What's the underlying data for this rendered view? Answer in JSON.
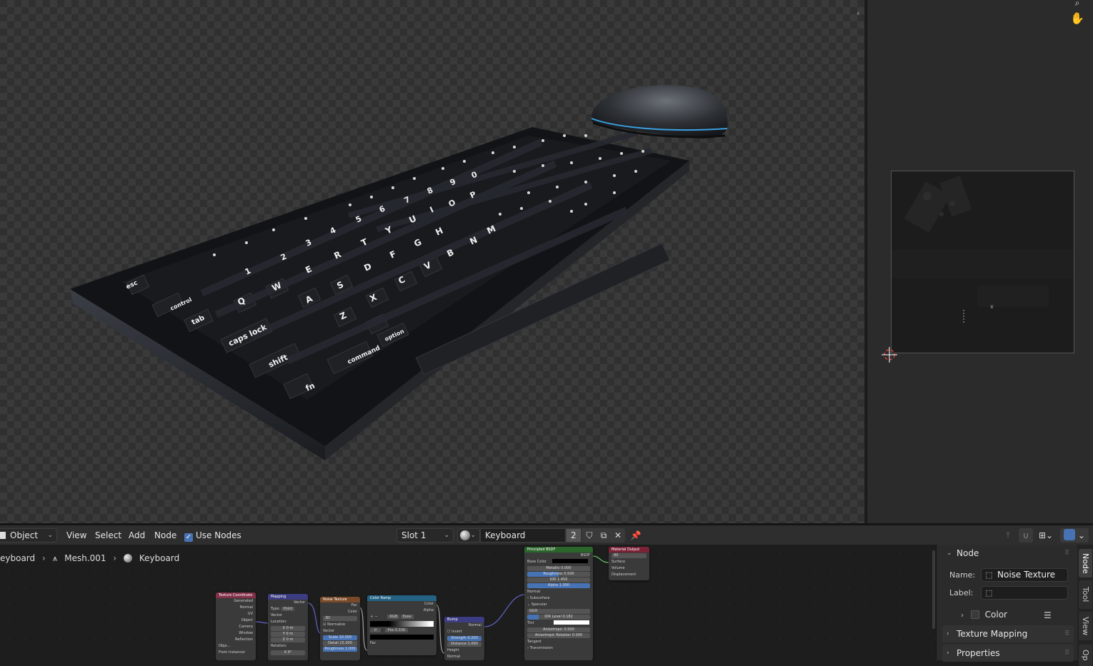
{
  "header": {
    "mode_dropdown": "Object",
    "menu": [
      "View",
      "Select",
      "Add",
      "Node"
    ],
    "use_nodes_label": "Use Nodes",
    "use_nodes_checked": true,
    "slot_dropdown": "Slot 1",
    "material_name": "Keyboard",
    "material_users": "2"
  },
  "breadcrumb": [
    "eyboard",
    "Mesh.001",
    "Keyboard"
  ],
  "nodes": {
    "texcoord": {
      "title": "Texture Coordinate",
      "outputs": [
        "Generated",
        "Normal",
        "UV",
        "Object",
        "Camera",
        "Window",
        "Reflection"
      ],
      "object_label": "Obje...",
      "from_instancer": "From Instancer"
    },
    "mapping": {
      "title": "Mapping",
      "out": "Vector",
      "type_label": "Type:",
      "type_value": "Point",
      "vector": "Vector",
      "location": "Location:",
      "x": "X",
      "y": "Y",
      "z": "Z",
      "loc_x": "0 m",
      "loc_y": "0 m",
      "loc_z": "0 m",
      "rotation": "Rotation:",
      "rot_x": "0°"
    },
    "noise": {
      "title": "Noise Texture",
      "out_fac": "Fac",
      "out_color": "Color",
      "dim": "3D",
      "normalize": "Normalize",
      "vector": "Vector",
      "scale_label": "Scale",
      "scale": "10.000",
      "detail_label": "Detail",
      "detail": "15.000",
      "rough_label": "Roughness",
      "rough": "1.000"
    },
    "ramp": {
      "title": "Color Ramp",
      "out_color": "Color",
      "out_alpha": "Alpha",
      "mode": "RGB",
      "interp": "Ease",
      "index": "0",
      "pos_label": "Pos",
      "pos": "0.336",
      "fac": "Fac"
    },
    "bump": {
      "title": "Bump",
      "out": "Normal",
      "invert": "Invert",
      "strength_label": "Strength",
      "strength": "0.200",
      "distance_label": "Distance",
      "distance": "1.000",
      "height": "Height",
      "normal": "Normal"
    },
    "bsdf": {
      "title": "Principled BSDF",
      "out": "BSDF",
      "base_color": "Base Color",
      "metallic_label": "Metallic",
      "metallic": "0.000",
      "roughness_label": "Roughness",
      "roughness": "0.500",
      "ior_label": "IOR",
      "ior": "1.450",
      "alpha_label": "Alpha",
      "alpha": "1.000",
      "normal": "Normal",
      "subsurface": "Subsurface",
      "specular": "Specular",
      "distribution": "GGX",
      "ior_level_label": "IOR Level",
      "ior_level": "0.182",
      "tint": "Tint",
      "aniso_label": "Anisotropic",
      "aniso": "0.000",
      "aniso_rot_label": "Anisotropic Rotation",
      "aniso_rot": "0.000",
      "tangent": "Tangent",
      "transmission": "Transmission"
    },
    "output": {
      "title": "Material Output",
      "target": "All",
      "surface": "Surface",
      "volume": "Volume",
      "displacement": "Displacement"
    }
  },
  "sidebar": {
    "tabs": [
      "Node",
      "Tool",
      "View",
      "Op"
    ],
    "node_panel": "Node",
    "name_label": "Name:",
    "name_value": "Noise Texture",
    "label_label": "Label:",
    "label_value": "",
    "color_sub": "Color",
    "texture_mapping": "Texture Mapping",
    "properties": "Properties"
  },
  "colors": {
    "accent": "#4772b3",
    "node_input_header": "#83314a",
    "node_vector_header": "#3c3c83",
    "node_texture_header": "#7a4a28",
    "node_converter_header": "#246283",
    "node_shader_header": "#2b652b",
    "node_output_header": "#7c2237"
  }
}
